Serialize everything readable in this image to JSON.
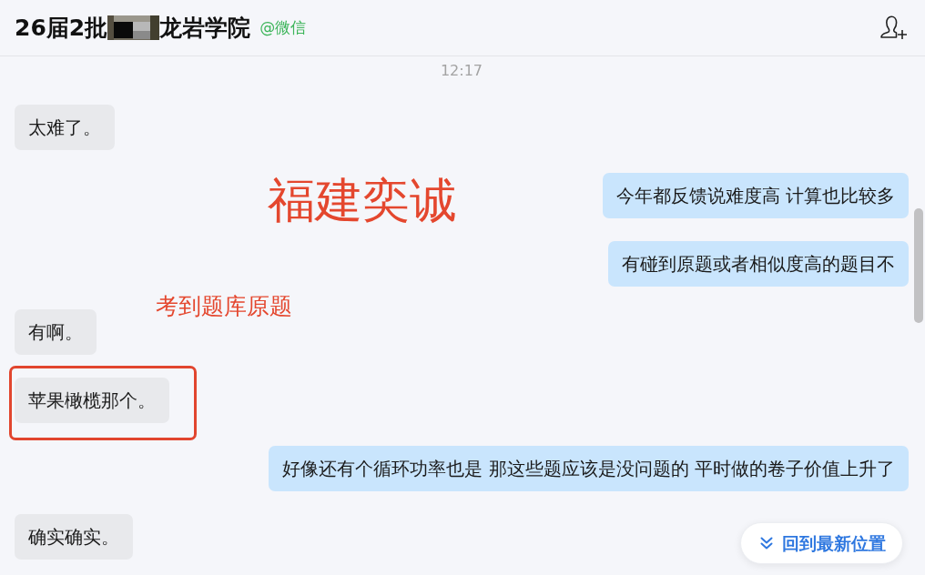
{
  "header": {
    "title_start": "26届2批",
    "title_end": "龙岩学院",
    "source": "@微信"
  },
  "timestamp": "12:17",
  "messages": [
    {
      "kind": "received",
      "text": "太难了。",
      "highlighted": false
    },
    {
      "kind": "sent",
      "text": "今年都反馈说难度高 计算也比较多",
      "highlighted": false
    },
    {
      "kind": "sent",
      "text": "有碰到原题或者相似度高的题目不",
      "highlighted": false
    },
    {
      "kind": "received",
      "text": "有啊。",
      "highlighted": false
    },
    {
      "kind": "received",
      "text": "苹果橄榄那个。",
      "highlighted": true
    },
    {
      "kind": "sent",
      "text": "好像还有个循环功率也是 那这些题应该是没问题的 平时做的卷子价值上升了",
      "highlighted": false
    },
    {
      "kind": "received",
      "text": "确实确实。",
      "highlighted": false
    }
  ],
  "annotations": [
    {
      "kind": "headline",
      "text": "福建奕诚"
    },
    {
      "kind": "note",
      "text": "考到题库原题"
    }
  ],
  "jump_button": {
    "label": "回到最新位置"
  }
}
